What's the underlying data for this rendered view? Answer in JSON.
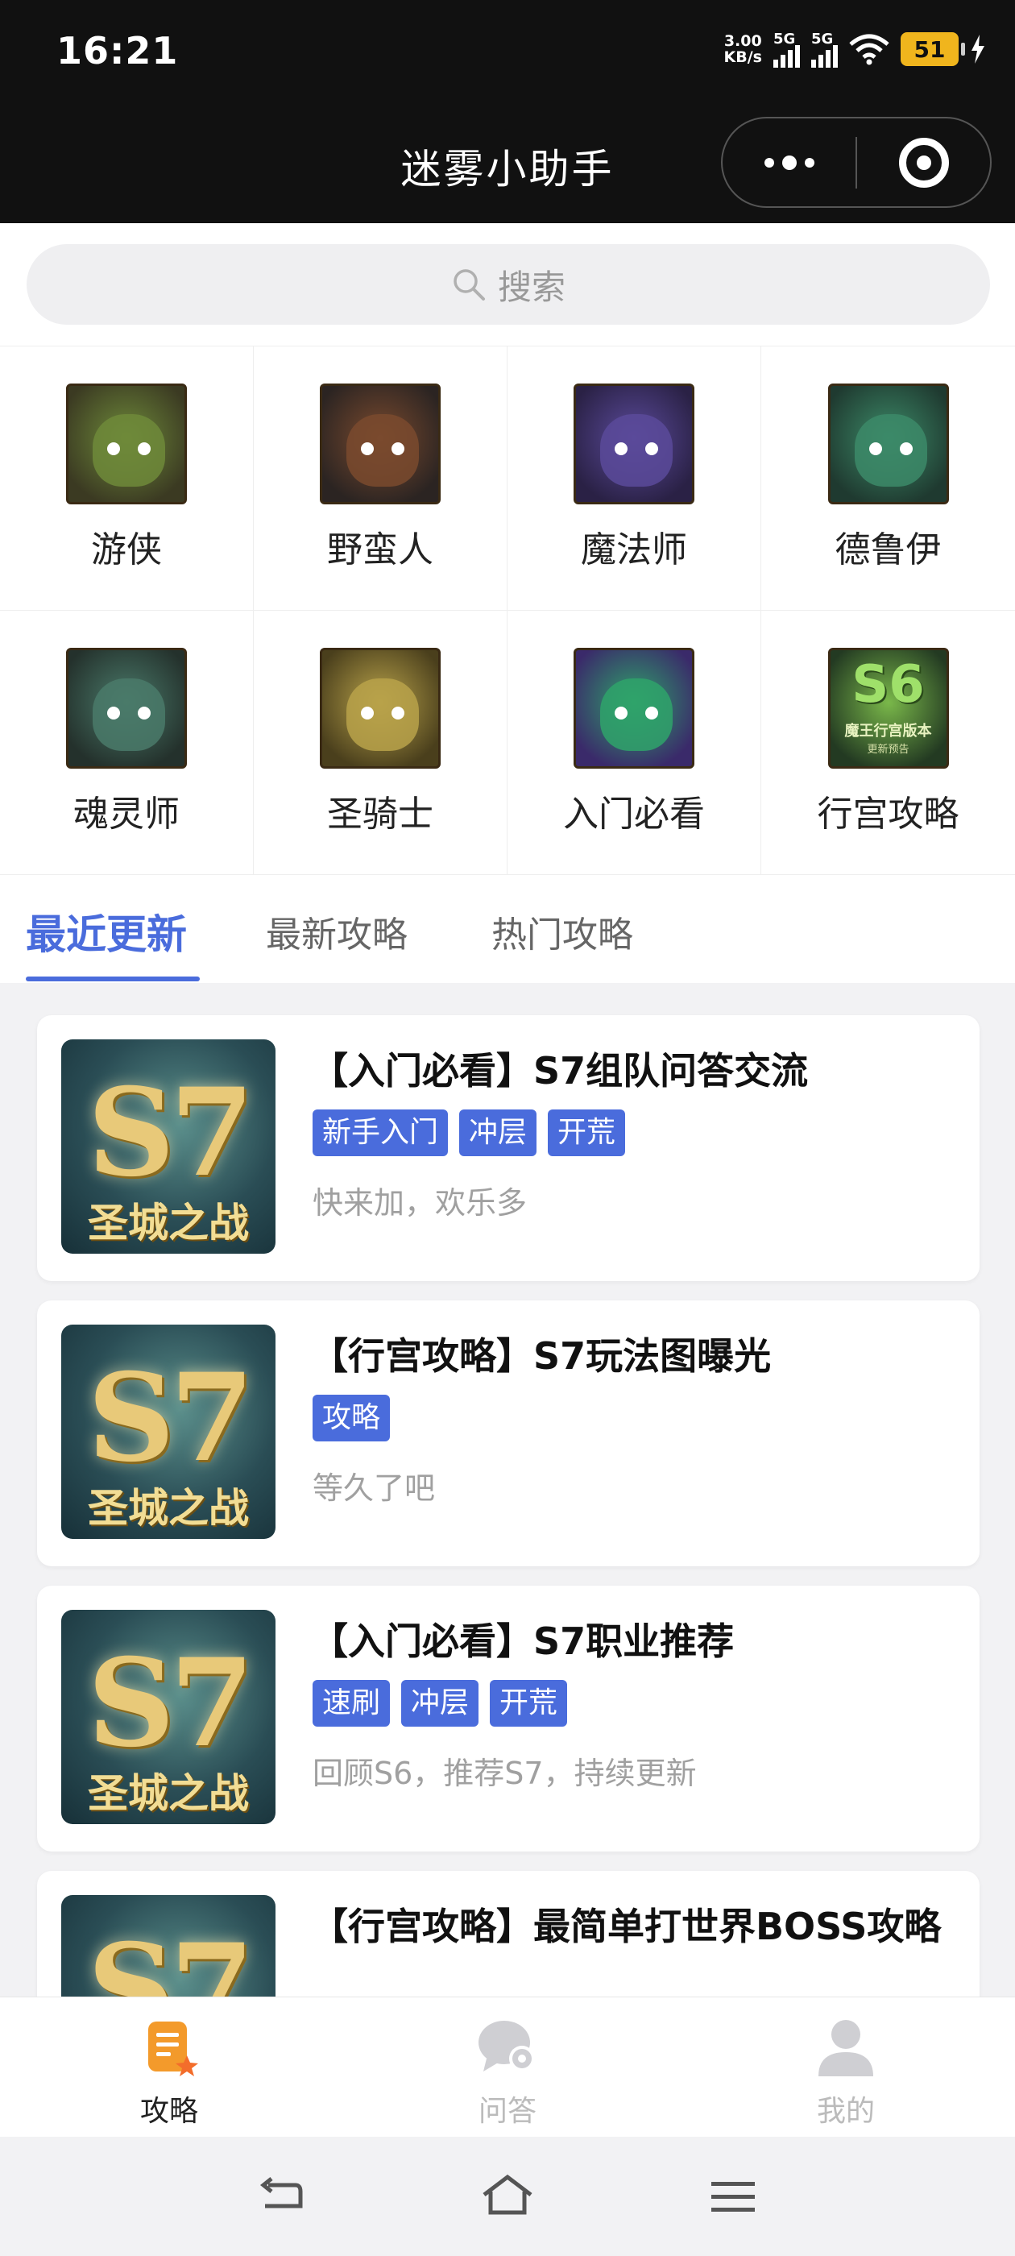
{
  "status_bar": {
    "time": "16:21",
    "net_speed_value": "3.00",
    "net_speed_unit": "KB/s",
    "sim1_label": "5G",
    "sim2_label": "5G",
    "battery": "51"
  },
  "header": {
    "title": "迷雾小助手"
  },
  "search": {
    "placeholder": "搜索"
  },
  "categories": [
    {
      "label": "游侠",
      "color": "#6e8a3a",
      "bg": "#3b3a22"
    },
    {
      "label": "野蛮人",
      "color": "#7a4a2e",
      "bg": "#2b2422"
    },
    {
      "label": "魔法师",
      "color": "#5a4a9a",
      "bg": "#2a2145"
    },
    {
      "label": "德鲁伊",
      "color": "#3c8a68",
      "bg": "#1f3a30"
    },
    {
      "label": "魂灵师",
      "color": "#4a7a6a",
      "bg": "#24312c"
    },
    {
      "label": "圣骑士",
      "color": "#b8a24a",
      "bg": "#4a3f1c"
    },
    {
      "label": "入门必看",
      "color": "#2fa36a",
      "bg": "#3a2a6a"
    },
    {
      "label": "行宫攻略",
      "color": "#7ab84a",
      "bg": "#233a22",
      "badge": "S6",
      "badge_sub": "魔王行宫版本",
      "badge_sub2": "更新预告"
    }
  ],
  "tabs": [
    {
      "label": "最近更新",
      "active": true
    },
    {
      "label": "最新攻略",
      "active": false
    },
    {
      "label": "热门攻略",
      "active": false
    }
  ],
  "thumbnail": {
    "big": "S7",
    "sub": "圣城之战"
  },
  "articles": [
    {
      "title": "【入门必看】S7组队问答交流",
      "tags": [
        "新手入门",
        "冲层",
        "开荒"
      ],
      "desc": "快来加，欢乐多"
    },
    {
      "title": "【行宫攻略】S7玩法图曝光",
      "tags": [
        "攻略"
      ],
      "desc": "等久了吧"
    },
    {
      "title": "【入门必看】S7职业推荐",
      "tags": [
        "速刷",
        "冲层",
        "开荒"
      ],
      "desc": "回顾S6，推荐S7，持续更新"
    },
    {
      "title": "【行宫攻略】最简单打世界BOSS攻略",
      "tags": [],
      "desc": ""
    }
  ],
  "bottom_nav": [
    {
      "label": "攻略",
      "icon": "guide-icon",
      "active": true
    },
    {
      "label": "问答",
      "icon": "chat-icon",
      "active": false
    },
    {
      "label": "我的",
      "icon": "user-icon",
      "active": false
    }
  ],
  "colors": {
    "accent": "#4a6cdc",
    "nav_active": "#f39a2b"
  }
}
